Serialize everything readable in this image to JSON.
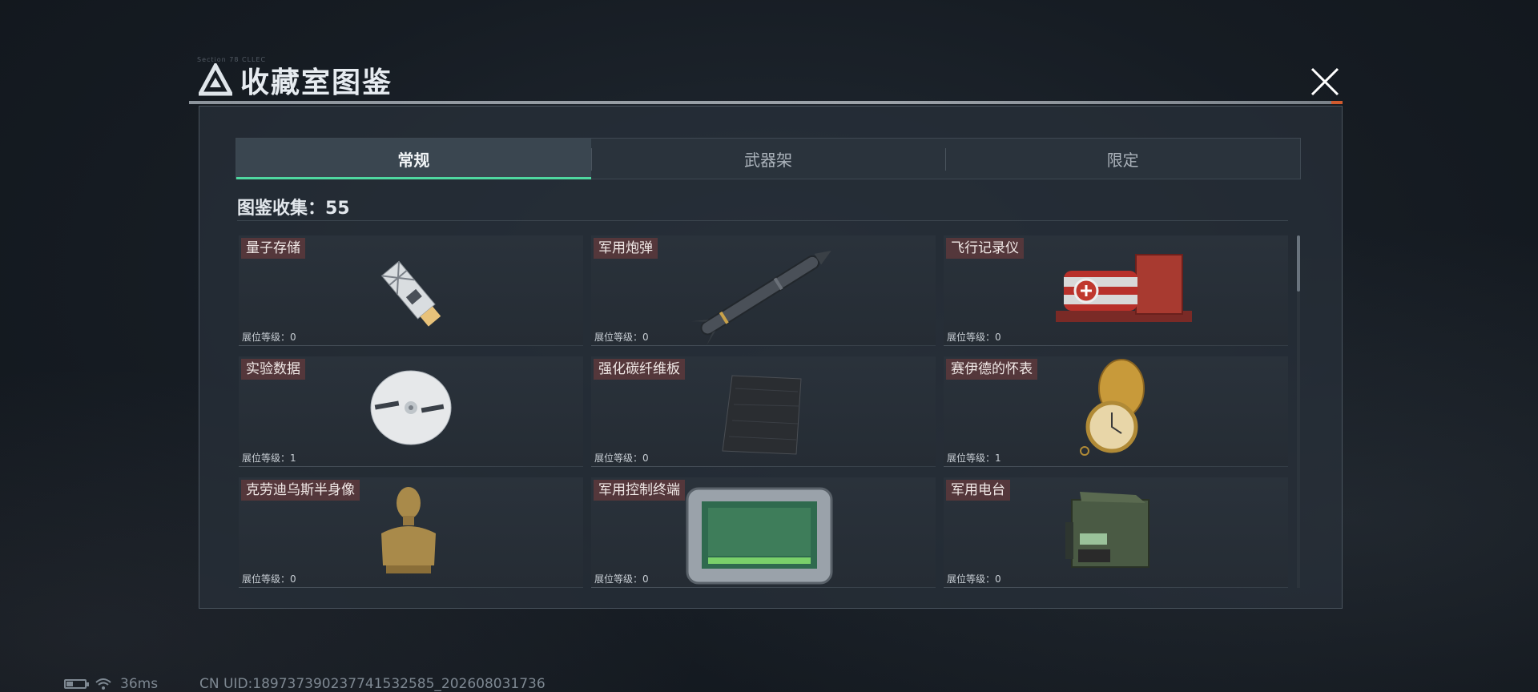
{
  "title": {
    "text": "收藏室图鉴",
    "deco": "Section 78 CLLEC",
    "logo_icon": "triangle-emblem-icon",
    "close_icon": "close-icon"
  },
  "tabs": [
    {
      "label": "常规",
      "active": true
    },
    {
      "label": "武器架",
      "active": false
    },
    {
      "label": "限定",
      "active": false
    }
  ],
  "collection": {
    "label": "图鉴收集：55"
  },
  "items": [
    {
      "name": "量子存储",
      "level": "展位等级：0",
      "icon": "usb-drive-icon"
    },
    {
      "name": "军用炮弹",
      "level": "展位等级：0",
      "icon": "missile-icon"
    },
    {
      "name": "飞行记录仪",
      "level": "展位等级：0",
      "icon": "flight-recorder-icon"
    },
    {
      "name": "实验数据",
      "level": "展位等级：1",
      "icon": "disc-icon"
    },
    {
      "name": "强化碳纤维板",
      "level": "展位等级：0",
      "icon": "carbon-plate-icon"
    },
    {
      "name": "赛伊德的怀表",
      "level": "展位等级：1",
      "icon": "pocket-watch-icon"
    },
    {
      "name": "克劳迪乌斯半身像",
      "level": "展位等级：0",
      "icon": "bust-icon"
    },
    {
      "name": "军用控制终端",
      "level": "展位等级：0",
      "icon": "control-terminal-icon"
    },
    {
      "name": "军用电台",
      "level": "展位等级：0",
      "icon": "radio-icon"
    }
  ],
  "status_bar": {
    "battery_icon": "battery-icon",
    "battery_level": 0.35,
    "wifi_icon": "wifi-icon",
    "ping": "36ms",
    "uid": "CN UID:189737390237741532585_202608031736"
  },
  "colors": {
    "accent": "#4fd8a0",
    "name_badge": "#7a3c3c",
    "title_accent": "#d05a2e"
  }
}
